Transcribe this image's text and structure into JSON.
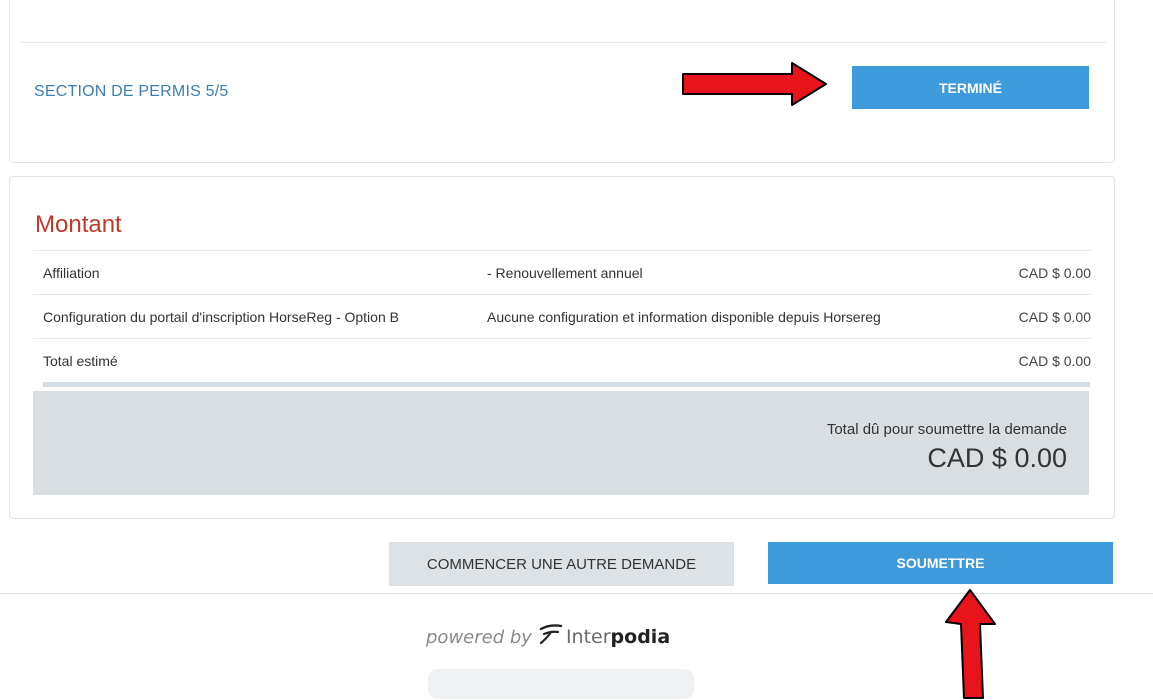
{
  "permit_section": {
    "label": "SECTION DE PERMIS 5/5",
    "done_button": "TERMINÉ"
  },
  "amount": {
    "title": "Montant",
    "rows": [
      {
        "item": "Affiliation",
        "description": "- Renouvellement annuel",
        "price": "CAD $ 0.00"
      },
      {
        "item": "Configuration du portail d'inscription HorseReg - Option B",
        "description": "Aucune configuration et information disponible depuis Horsereg",
        "price": "CAD $ 0.00"
      },
      {
        "item": "Total estimé",
        "description": "",
        "price": "CAD $ 0.00"
      }
    ],
    "due_label": "Total dû pour soumettre la demande",
    "due_amount": "CAD $ 0.00"
  },
  "actions": {
    "new_request": "COMMENCER UNE AUTRE DEMANDE",
    "submit": "SOUMETTRE"
  },
  "footer": {
    "powered_by": "powered by",
    "brand_a": "Inter",
    "brand_b": "podia"
  },
  "colors": {
    "primary": "#3e9bdb",
    "accent_red": "#c0392b",
    "annotation_arrow": "#e8141b"
  }
}
